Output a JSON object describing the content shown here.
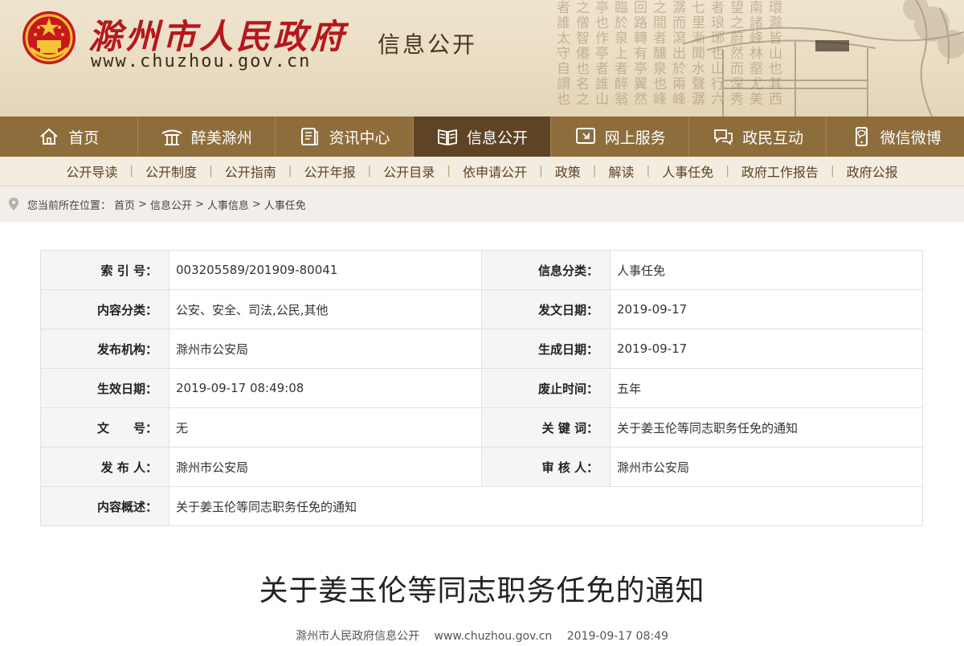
{
  "header": {
    "site_title": "滁州市人民政府",
    "site_url": "www.chuzhou.gov.cn",
    "section_label": "信息公开",
    "calligraphy": "環滁皆山也其西南諸峰林壑尤美望之蔚然而深秀者琅琊也山行六七里漸聞水聲潺潺而瀉出於兩峰之間者釀泉也峰回路轉有亭翼然臨於泉上者醉翁亭也作亭者誰山之僧智僊也名之者誰太守自謂也"
  },
  "mainnav": {
    "items": [
      {
        "label": "首页",
        "icon": "home-icon"
      },
      {
        "label": "醉美滁州",
        "icon": "pavilion-icon"
      },
      {
        "label": "资讯中心",
        "icon": "document-icon"
      },
      {
        "label": "信息公开",
        "icon": "book-icon"
      },
      {
        "label": "网上服务",
        "icon": "service-icon"
      },
      {
        "label": "政民互动",
        "icon": "chat-icon"
      },
      {
        "label": "微信微博",
        "icon": "mobile-icon"
      }
    ],
    "active_index": 3
  },
  "subnav": {
    "items": [
      "公开导读",
      "公开制度",
      "公开指南",
      "公开年报",
      "公开目录",
      "依申请公开",
      "政策",
      "解读",
      "人事任免",
      "政府工作报告",
      "政府公报"
    ]
  },
  "breadcrumb": {
    "prefix": "您当前所在位置：",
    "items": [
      "首页",
      "信息公开",
      "人事信息",
      "人事任免"
    ],
    "separator": ">"
  },
  "meta": {
    "rows": [
      {
        "k1": "索 引 号：",
        "v1": "003205589/201909-80041",
        "k2": "信息分类：",
        "v2": "人事任免"
      },
      {
        "k1": "内容分类：",
        "v1": "公安、安全、司法,公民,其他",
        "k2": "发文日期：",
        "v2": "2019-09-17"
      },
      {
        "k1": "发布机构：",
        "v1": "滁州市公安局",
        "k2": "生成日期：",
        "v2": "2019-09-17"
      },
      {
        "k1": "生效日期：",
        "v1": "2019-09-17 08:49:08",
        "k2": "废止时间：",
        "v2": "五年"
      },
      {
        "k1": "文　　号：",
        "v1": "无",
        "k2": "关 键 词：",
        "v2": "关于姜玉伦等同志职务任免的通知"
      },
      {
        "k1": "发 布 人：",
        "v1": "滁州市公安局",
        "k2": "审 核 人：",
        "v2": "滁州市公安局"
      }
    ],
    "summary_key": "内容概述：",
    "summary_value": "关于姜玉伦等同志职务任免的通知"
  },
  "article": {
    "title": "关于姜玉伦等同志职务任免的通知",
    "source": "滁州市人民政府信息公开",
    "site": "www.chuzhou.gov.cn",
    "datetime": "2019-09-17 08:49"
  },
  "colors": {
    "nav_bg": "#8e6d3c",
    "nav_active": "#5e4424",
    "title_red": "#b5181c"
  }
}
